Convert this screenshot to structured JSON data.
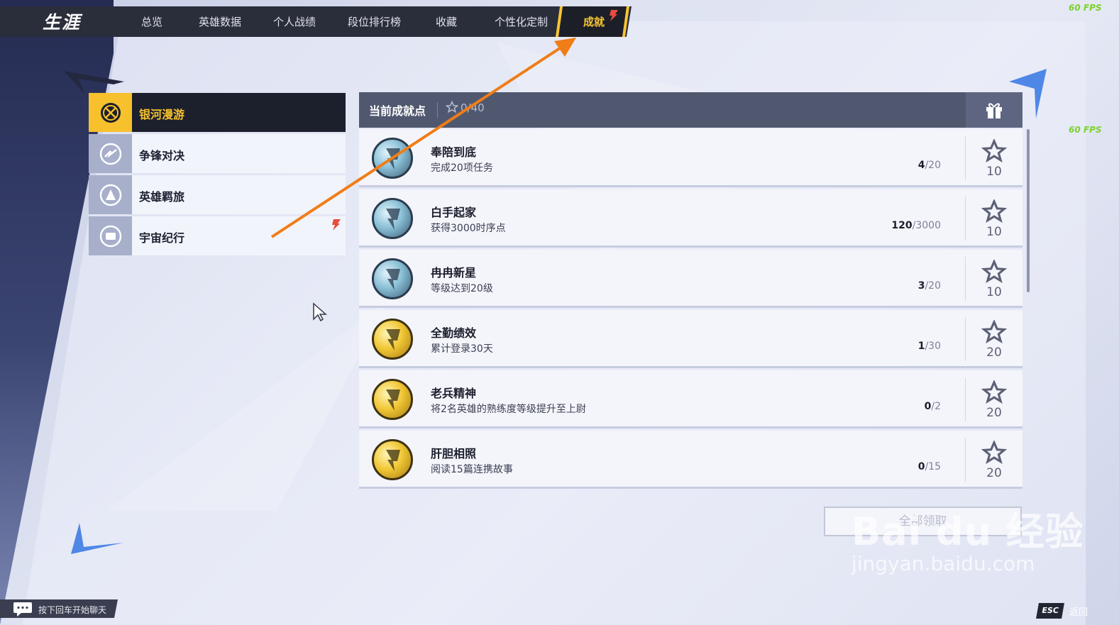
{
  "colors": {
    "accent": "#f6c12d",
    "topbar": "#2a2d3a",
    "panel_header": "#50586f",
    "arrow": "#f07d18",
    "fps_green": "#7ad32b"
  },
  "header": {
    "brand": "生涯",
    "tabs": [
      {
        "label": "总览"
      },
      {
        "label": "英雄数据"
      },
      {
        "label": "个人战绩"
      },
      {
        "label": "段位排行榜"
      },
      {
        "label": "收藏"
      },
      {
        "label": "个性化定制"
      }
    ],
    "active_tab": "成就"
  },
  "fps": {
    "top": "60 FPS",
    "mid": "60 FPS"
  },
  "categories": [
    {
      "label": "银河漫游",
      "icon": "galaxy-icon",
      "active": true
    },
    {
      "label": "争锋对决",
      "icon": "versus-icon",
      "active": false
    },
    {
      "label": "英雄羁旅",
      "icon": "hero-icon",
      "active": false
    },
    {
      "label": "宇宙纪行",
      "icon": "cosmos-icon",
      "active": false,
      "new_flag": true
    }
  ],
  "panel": {
    "title": "当前成就点",
    "points": "0/40",
    "gift_icon": "gift-icon"
  },
  "achievements": [
    {
      "title": "奉陪到底",
      "desc": "完成20项任务",
      "current": "4",
      "total": "/20",
      "reward": "10",
      "medal": "silver"
    },
    {
      "title": "白手起家",
      "desc": "获得3000时序点",
      "current": "120",
      "total": "/3000",
      "reward": "10",
      "medal": "silver"
    },
    {
      "title": "冉冉新星",
      "desc": "等级达到20级",
      "current": "3",
      "total": "/20",
      "reward": "10",
      "medal": "silver"
    },
    {
      "title": "全勤绩效",
      "desc": "累计登录30天",
      "current": "1",
      "total": "/30",
      "reward": "20",
      "medal": "gold"
    },
    {
      "title": "老兵精神",
      "desc": "将2名英雄的熟练度等级提升至上尉",
      "current": "0",
      "total": "/2",
      "reward": "20",
      "medal": "gold"
    },
    {
      "title": "肝胆相照",
      "desc": "阅读15篇连携故事",
      "current": "0",
      "total": "/15",
      "reward": "20",
      "medal": "gold"
    }
  ],
  "claim_all": "全部领取",
  "chat_hint": "按下回车开始聊天",
  "esc": {
    "key": "ESC",
    "label": "返回"
  },
  "watermark": {
    "main": "Bai du 经验",
    "sub": "jingyan.baidu.com"
  }
}
